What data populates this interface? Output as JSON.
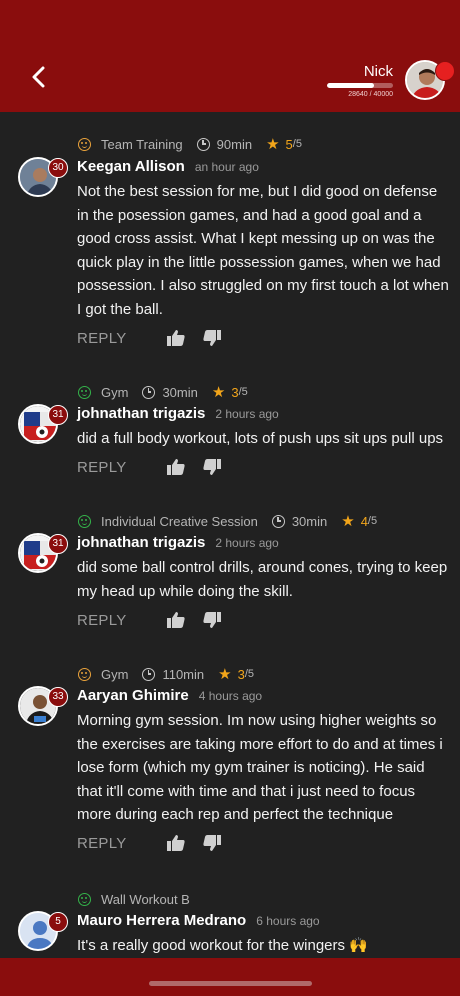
{
  "header": {
    "user_name": "Nick",
    "xp_text": "28640 / 40000",
    "xp_progress": 0.716
  },
  "colors": {
    "brand": "#8a0d0d",
    "background": "#212121",
    "star": "#f2a51a",
    "mood_neutral": "#e9a23b",
    "mood_good": "#34b24a"
  },
  "posts": [
    {
      "session": "Team Training",
      "mood_icon": "neutral-face-icon",
      "duration": "90min",
      "rating": "5",
      "rating_max": "/5",
      "badge": "30",
      "author": "Keegan Allison",
      "time": "an hour ago",
      "text": "Not the best session for me, but I did good on defense in the posession games, and had a good goal and a good cross assist. What I kept messing up on was the quick play in the little possession games, when we had possession. I also struggled on my first touch a lot when I got the ball.",
      "reply_label": "REPLY"
    },
    {
      "session": "Gym",
      "mood_icon": "happy-face-icon",
      "duration": "30min",
      "rating": "3",
      "rating_max": "/5",
      "badge": "31",
      "author": "johnathan trigazis",
      "time": "2 hours ago",
      "text": "did a full body workout, lots of push ups sit ups pull ups",
      "reply_label": "REPLY"
    },
    {
      "session": "Individual Creative Session",
      "mood_icon": "happy-face-icon",
      "duration": "30min",
      "rating": "4",
      "rating_max": "/5",
      "badge": "31",
      "author": "johnathan trigazis",
      "time": "2 hours ago",
      "text": "did some ball control drills, around cones, trying to keep my head up while doing the skill.",
      "reply_label": "REPLY"
    },
    {
      "session": "Gym",
      "mood_icon": "neutral-face-icon",
      "duration": "110min",
      "rating": "3",
      "rating_max": "/5",
      "badge": "33",
      "author": "Aaryan Ghimire",
      "time": "4 hours ago",
      "text": "Morning gym session. Im now using higher weights so the exercises are taking more effort to do and at times i lose form (which my gym trainer is noticing). He said that it'll come with time and that i just need to focus more during each rep and perfect the technique",
      "reply_label": "REPLY"
    },
    {
      "session": "Wall Workout B",
      "mood_icon": "happy-face-icon",
      "badge": "5",
      "author": "Mauro Herrera Medrano",
      "time": "6 hours ago",
      "text": "It's a really good workout for the wingers 🙌"
    }
  ]
}
